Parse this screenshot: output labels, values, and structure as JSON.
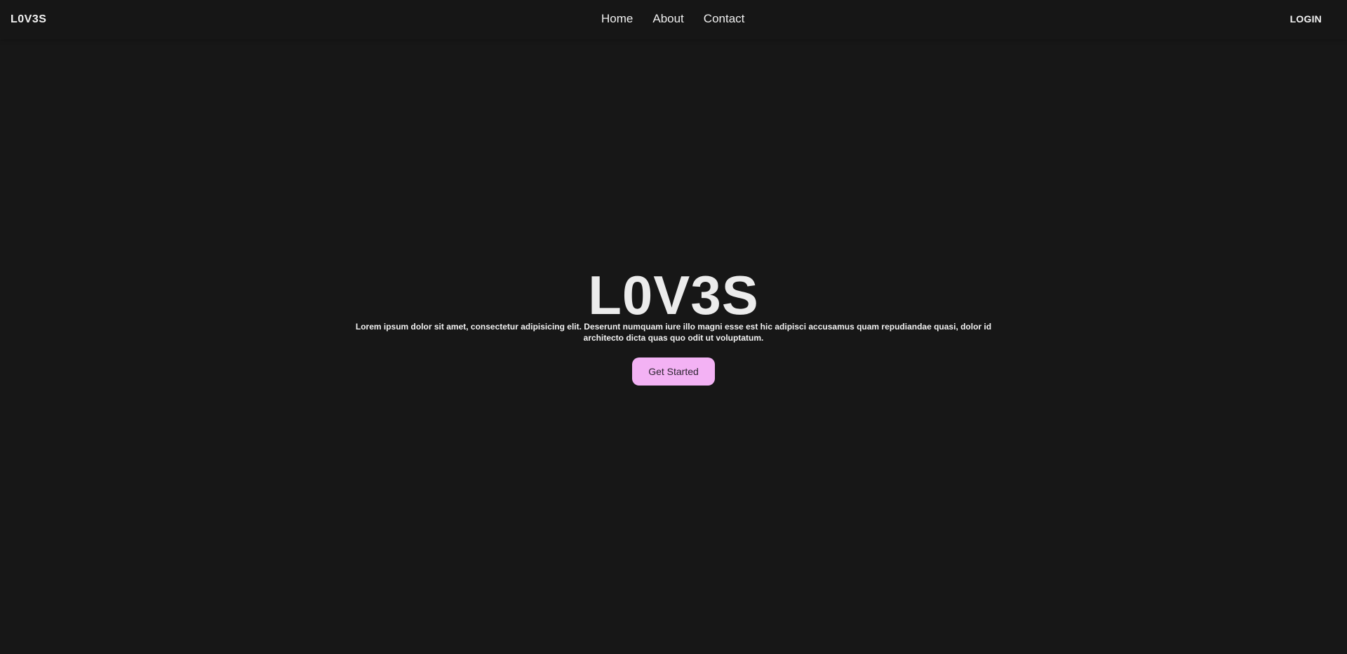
{
  "navbar": {
    "brand": "L0V3S",
    "links": [
      {
        "label": "Home"
      },
      {
        "label": "About"
      },
      {
        "label": "Contact"
      }
    ],
    "login_label": "LOGIN"
  },
  "hero": {
    "title": "L0V3S",
    "description": "Lorem ipsum dolor sit amet, consectetur adipisicing elit. Deserunt numquam iure illo magni esse est hic adipisci accusamus quam repudiandae quasi, dolor id architecto dicta quas quo odit ut voluptatum.",
    "cta_label": "Get Started"
  },
  "colors": {
    "background": "#171717",
    "navbar_background": "#161616",
    "text": "#ececec",
    "button_background": "#f3b2f4",
    "button_text": "#2c2330"
  }
}
